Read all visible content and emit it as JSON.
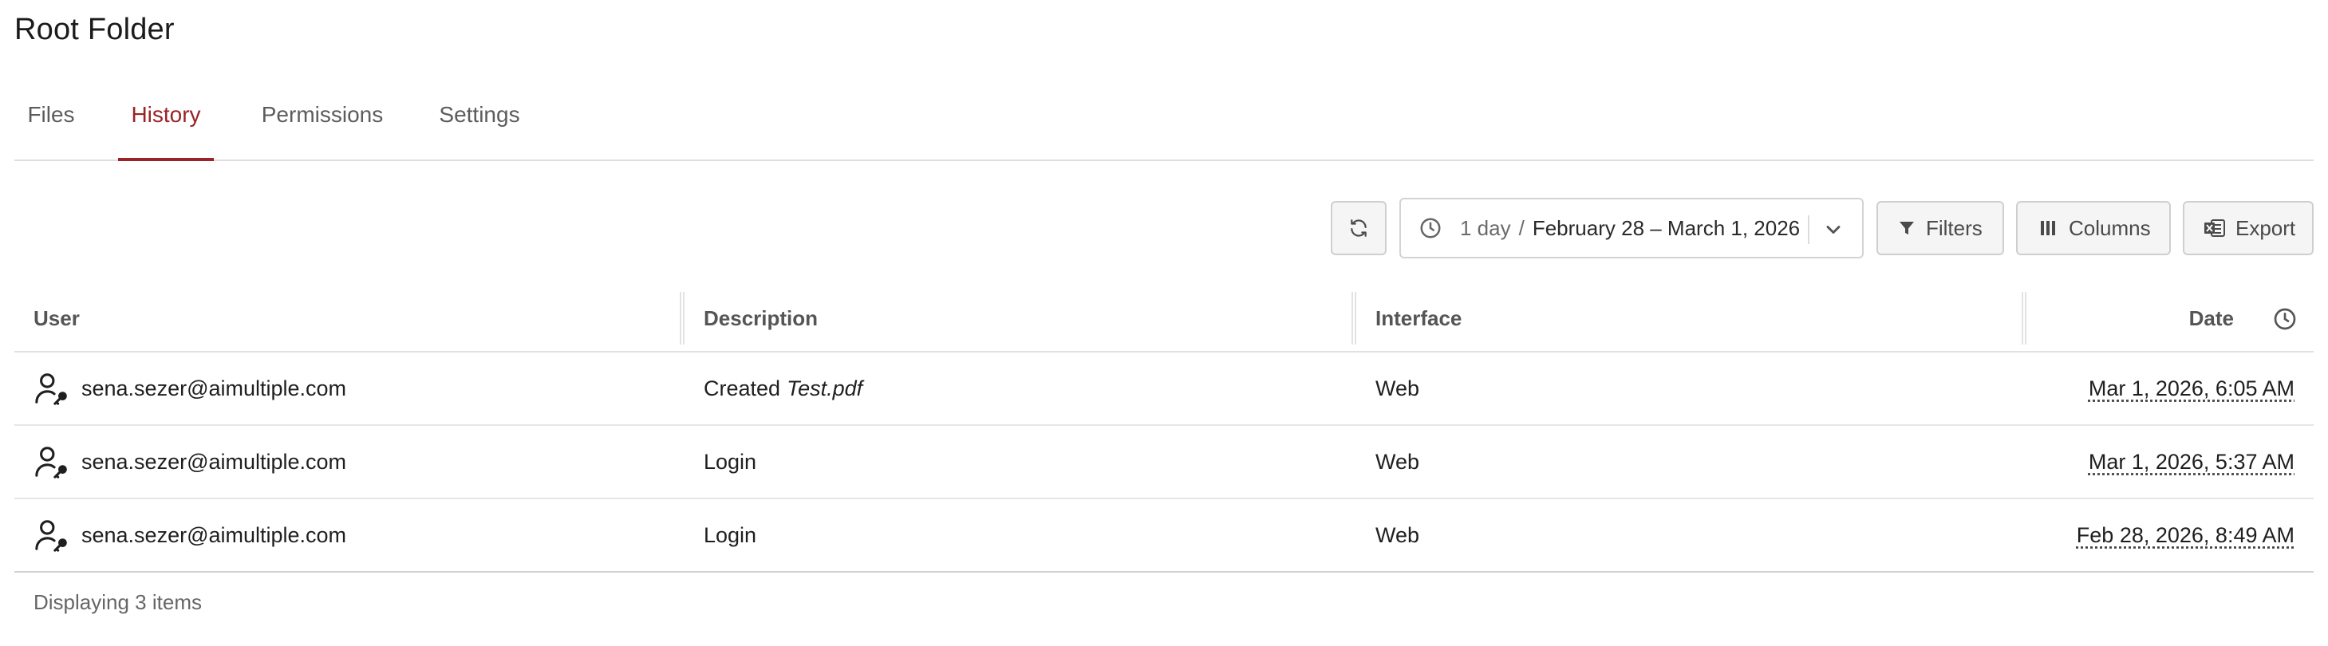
{
  "page": {
    "title": "Root Folder"
  },
  "tabs": [
    {
      "label": "Files"
    },
    {
      "label": "History"
    },
    {
      "label": "Permissions"
    },
    {
      "label": "Settings"
    }
  ],
  "active_tab": "History",
  "toolbar": {
    "date_range": {
      "span": "1 day",
      "separator": "/",
      "range": "February 28 – March 1, 2026"
    },
    "filters_label": "Filters",
    "columns_label": "Columns",
    "export_label": "Export"
  },
  "table": {
    "columns": [
      "User",
      "Description",
      "Interface",
      "Date"
    ],
    "rows": [
      {
        "user": "sena.sezer@aimultiple.com",
        "description": "Created",
        "description_file": "Test.pdf",
        "interface": "Web",
        "date": "Mar 1, 2026, 6:05 AM"
      },
      {
        "user": "sena.sezer@aimultiple.com",
        "description": "Login",
        "description_file": "",
        "interface": "Web",
        "date": "Mar 1, 2026, 5:37 AM"
      },
      {
        "user": "sena.sezer@aimultiple.com",
        "description": "Login",
        "description_file": "",
        "interface": "Web",
        "date": "Feb 28, 2026, 8:49 AM"
      }
    ]
  },
  "footer": {
    "status": "Displaying 3 items"
  },
  "colors": {
    "accent": "#9b2226",
    "border": "#cfcfcf",
    "muted_text": "#666666"
  }
}
